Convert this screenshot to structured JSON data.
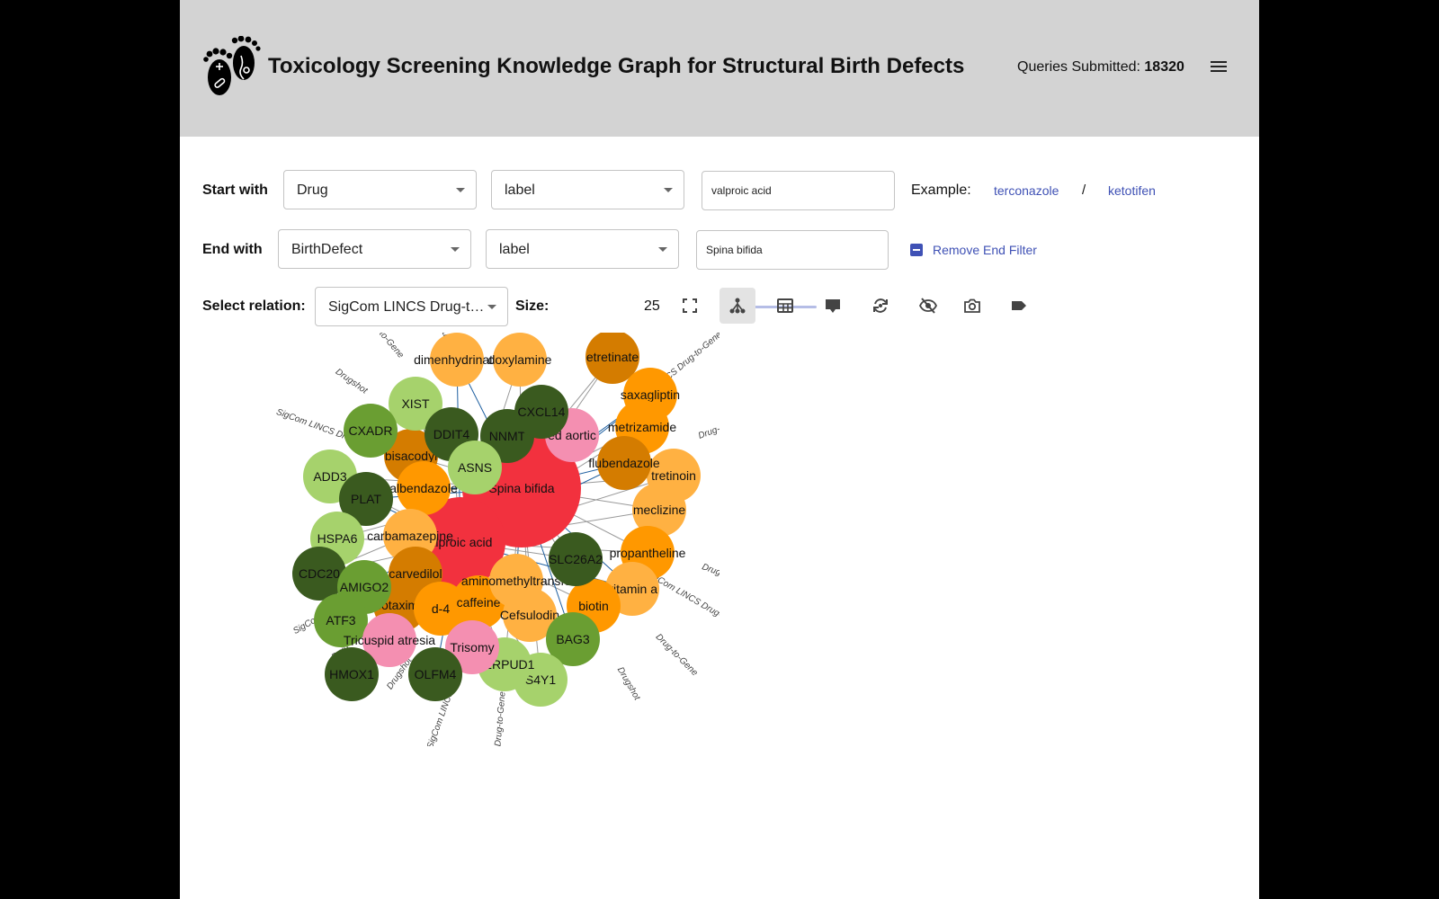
{
  "header": {
    "title": "Toxicology Screening Knowledge Graph for Structural Birth Defects",
    "queries_label": "Queries Submitted:",
    "queries_count": "18320",
    "logo_icon": "baby-footprints-logo",
    "menu_icon": "hamburger-menu-icon"
  },
  "start": {
    "label": "Start with",
    "type": "Drug",
    "field": "label",
    "value": "valproic acid"
  },
  "examples": {
    "label": "Example:",
    "first": "terconazole",
    "separator": "/",
    "second": "ketotifen"
  },
  "end": {
    "label": "End with",
    "type": "BirthDefect",
    "field": "label",
    "value": "Spina bifida",
    "remove_label": "Remove End Filter"
  },
  "relation": {
    "label": "Select relation:",
    "value": "SigCom LINCS Drug-t…"
  },
  "size": {
    "label": "Size:",
    "value": "25",
    "slider_fraction": 0.0
  },
  "toolbar": {
    "icons": [
      "fullscreen-icon",
      "network-layout-icon",
      "table-view-icon",
      "tooltip-icon",
      "reload-icon",
      "hide-icon",
      "screenshot-icon",
      "label-icon"
    ],
    "active": "network-layout-icon"
  },
  "colors": {
    "header_bg": "#d3d3d3",
    "accent": "#3f51b5",
    "birth_defect_main": "#f2313e",
    "birth_defect": "#f48fb1",
    "drug_light": "#ffb142",
    "drug": "#ff9800",
    "drug_dark": "#d47c00",
    "gene_dark": "#3a5a1f",
    "gene_mid": "#6a9e32",
    "gene_light": "#a6d26c"
  },
  "graph": {
    "nodes": [
      {
        "label": "Spina bifida",
        "kind": "birth_defect_main"
      },
      {
        "label": "alproic acid",
        "kind": "birth_defect_main"
      },
      {
        "label": "ed aortic",
        "kind": "birth_defect"
      },
      {
        "label": "dimenhydrinate",
        "kind": "drug_light"
      },
      {
        "label": "doxylamine",
        "kind": "drug_light"
      },
      {
        "label": "etretinate",
        "kind": "drug_dark"
      },
      {
        "label": "saxagliptin",
        "kind": "drug"
      },
      {
        "label": "metrizamide",
        "kind": "drug"
      },
      {
        "label": "tretinoin",
        "kind": "drug_light"
      },
      {
        "label": "flubendazole",
        "kind": "drug_dark"
      },
      {
        "label": "meclizine",
        "kind": "drug_light"
      },
      {
        "label": "propantheline",
        "kind": "drug"
      },
      {
        "label": "vitamin a",
        "kind": "drug_light"
      },
      {
        "label": "biotin",
        "kind": "drug"
      },
      {
        "label": "bisacodyl",
        "kind": "drug_dark"
      },
      {
        "label": "albendazole",
        "kind": "drug"
      },
      {
        "label": "carbamazepine",
        "kind": "drug_light"
      },
      {
        "label": "carvedilol",
        "kind": "drug_dark"
      },
      {
        "label": "cotaxime",
        "kind": "drug_dark"
      },
      {
        "label": "d-4",
        "kind": "drug"
      },
      {
        "label": "caffeine",
        "kind": "drug"
      },
      {
        "label": "aminomethyltransfe",
        "kind": "drug_light"
      },
      {
        "label": "Cefsulodin",
        "kind": "drug_light"
      },
      {
        "label": "XIST",
        "kind": "gene_light"
      },
      {
        "label": "CXADR",
        "kind": "gene_mid"
      },
      {
        "label": "DDIT4",
        "kind": "gene_dark"
      },
      {
        "label": "NNMT",
        "kind": "gene_dark"
      },
      {
        "label": "CXCL14",
        "kind": "gene_dark"
      },
      {
        "label": "ASNS",
        "kind": "gene_light"
      },
      {
        "label": "ADD3",
        "kind": "gene_light"
      },
      {
        "label": "PLAT",
        "kind": "gene_dark"
      },
      {
        "label": "HSPA6",
        "kind": "gene_light"
      },
      {
        "label": "CDC20",
        "kind": "gene_dark"
      },
      {
        "label": "AMIGO2",
        "kind": "gene_mid"
      },
      {
        "label": "ATF3",
        "kind": "gene_mid"
      },
      {
        "label": "SLC26A2",
        "kind": "gene_dark"
      },
      {
        "label": "BAG3",
        "kind": "gene_mid"
      },
      {
        "label": "S4Y1",
        "kind": "gene_light"
      },
      {
        "label": "HERPUD1",
        "kind": "gene_light"
      },
      {
        "label": "Trisomy",
        "kind": "birth_defect"
      },
      {
        "label": "Tricuspid atresia",
        "kind": "birth_defect"
      },
      {
        "label": "HMOX1",
        "kind": "gene_dark"
      },
      {
        "label": "OLFM4",
        "kind": "gene_dark"
      }
    ],
    "edge_labels": [
      "SigCom LINCS Drug-to-Gene",
      "Drugshot",
      "Drug-to-Gene"
    ]
  }
}
